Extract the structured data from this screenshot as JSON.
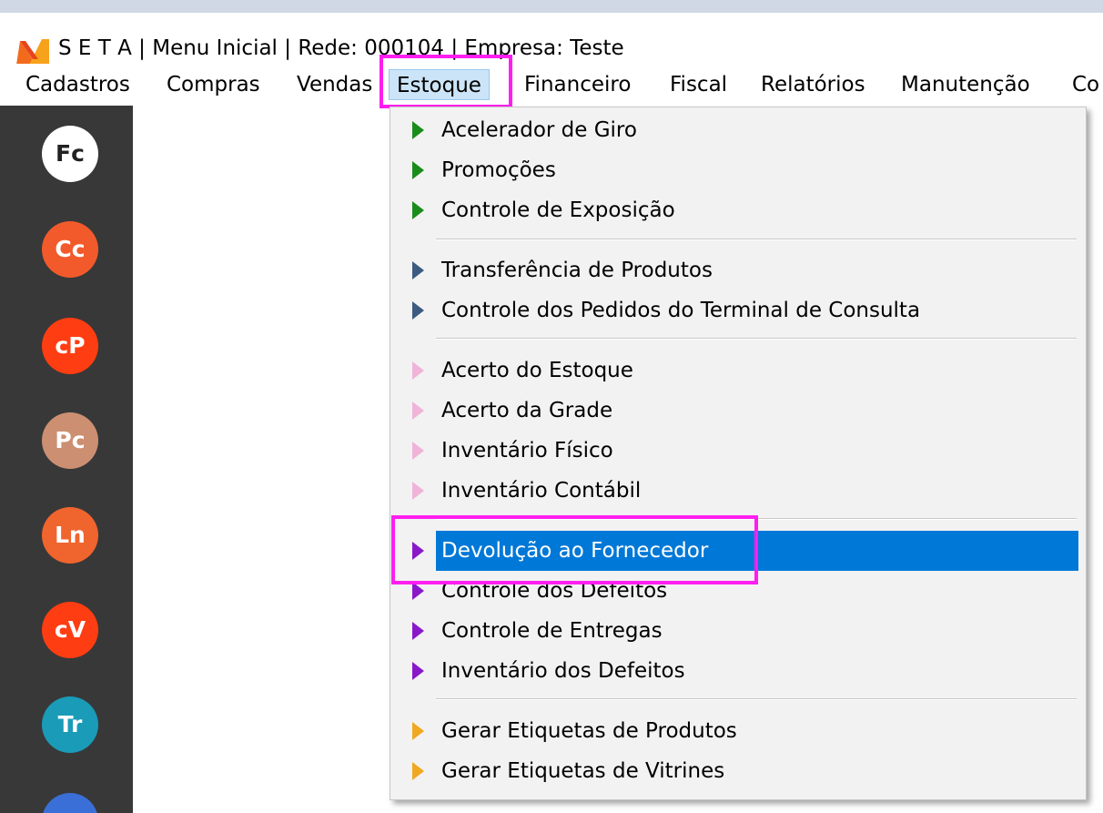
{
  "window": {
    "title": "S E T A | Menu Inicial | Rede: 000104 | Empresa: Teste"
  },
  "menubar": {
    "items": [
      "Cadastros",
      "Compras",
      "Vendas",
      "Estoque",
      "Financeiro",
      "Fiscal",
      "Relatórios",
      "Manutenção",
      "Co"
    ],
    "open_item": "Estoque"
  },
  "sidebar": {
    "buttons": [
      {
        "label": "Fc",
        "color": "#ffffff"
      },
      {
        "label": "Cc",
        "color": "#f25a2b"
      },
      {
        "label": "cP",
        "color": "#ff3d12"
      },
      {
        "label": "Pc",
        "color": "#cc8f72"
      },
      {
        "label": "Ln",
        "color": "#f0642e"
      },
      {
        "label": "cV",
        "color": "#ff3d12"
      },
      {
        "label": "Tr",
        "color": "#1a9bb8"
      },
      {
        "label": "",
        "color": "#3a6fd8"
      }
    ]
  },
  "dropdown": {
    "items": [
      {
        "label": "Acelerador de Giro",
        "arrow_color": "#1a8c1a"
      },
      {
        "label": "Promoções",
        "arrow_color": "#1a8c1a"
      },
      {
        "label": "Controle de Exposição",
        "arrow_color": "#1a8c1a"
      },
      {
        "label": "Transferência de Produtos",
        "arrow_color": "#3d5a80"
      },
      {
        "label": "Controle dos Pedidos do Terminal de Consulta",
        "arrow_color": "#3d5a80"
      },
      {
        "label": "Acerto do Estoque",
        "arrow_color": "#f0b4d8"
      },
      {
        "label": "Acerto da Grade",
        "arrow_color": "#f0b4d8"
      },
      {
        "label": "Inventário Físico",
        "arrow_color": "#f0b4d8"
      },
      {
        "label": "Inventário Contábil",
        "arrow_color": "#f0b4d8"
      },
      {
        "label": "Devolução ao Fornecedor",
        "arrow_color": "#8a18c8",
        "selected": true
      },
      {
        "label": "Controle dos Defeitos",
        "arrow_color": "#8a18c8"
      },
      {
        "label": "Controle de Entregas",
        "arrow_color": "#8a18c8"
      },
      {
        "label": "Inventário dos Defeitos",
        "arrow_color": "#8a18c8"
      },
      {
        "label": "Gerar Etiquetas de Produtos",
        "arrow_color": "#f0a820"
      },
      {
        "label": "Gerar Etiquetas de Vitrines",
        "arrow_color": "#f0a820"
      }
    ]
  },
  "colors": {
    "highlight_box": "#ff1ef0",
    "selection": "#0078d7",
    "sidebar_bg": "#383838"
  }
}
